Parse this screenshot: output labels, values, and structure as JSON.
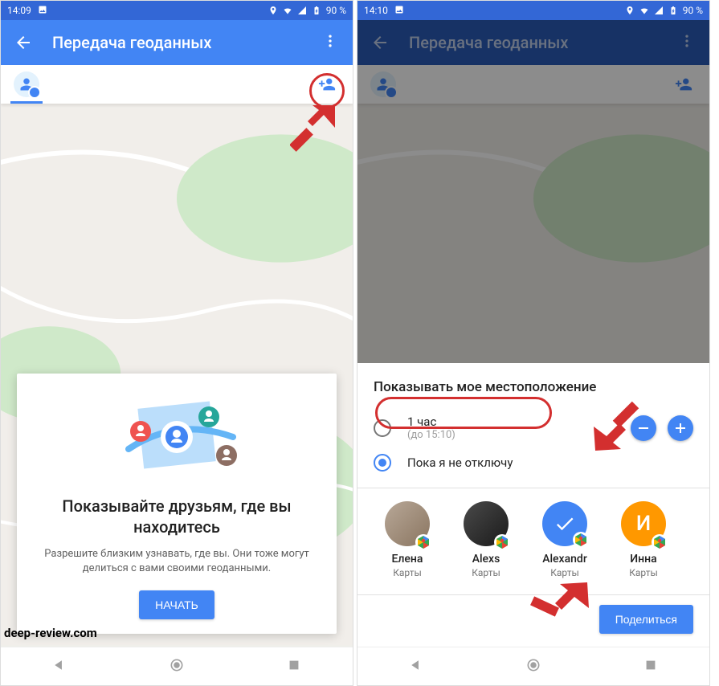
{
  "left": {
    "status": {
      "time": "14:09",
      "battery": "90 %"
    },
    "appbar": {
      "title": "Передача геоданных"
    },
    "intro": {
      "heading": "Показывайте друзьям, где вы находитесь",
      "body": "Разрешите близким узнавать, где вы. Они тоже могут делиться с вами своими геоданными.",
      "cta": "НАЧАТЬ"
    },
    "watermark": "deep-review.com"
  },
  "right": {
    "status": {
      "time": "14:10",
      "battery": "90 %"
    },
    "appbar": {
      "title": "Передача геоданных"
    },
    "sheet": {
      "heading": "Показывать мое местоположение",
      "opt1": {
        "label": "1 час",
        "detail": "(до 15:10)"
      },
      "opt2": {
        "label": "Пока я не отключу"
      },
      "share_button": "Поделиться",
      "contacts": [
        {
          "name": "Елена",
          "source": "Карты",
          "avatar": "photo1"
        },
        {
          "name": "Alexs",
          "source": "Карты",
          "avatar": "photo2"
        },
        {
          "name": "Alexandr",
          "source": "Карты",
          "avatar": "selected"
        },
        {
          "name": "Инна",
          "source": "Карты",
          "avatar": "letter",
          "letter": "И"
        }
      ]
    }
  },
  "colors": {
    "primary": "#4285f4",
    "annotation": "#d32f2f"
  }
}
